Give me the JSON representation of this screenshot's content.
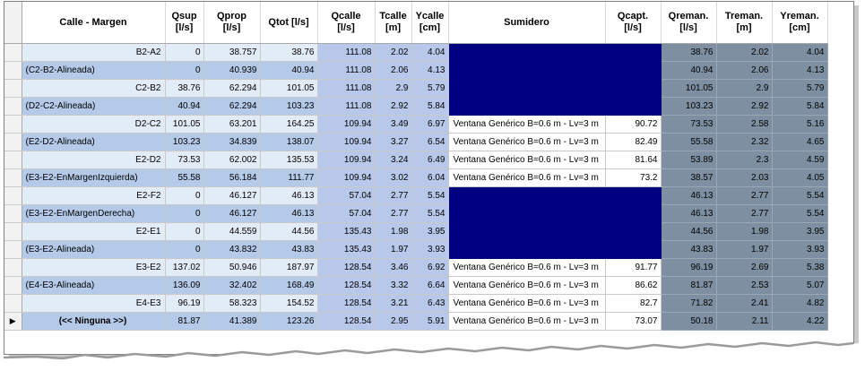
{
  "headers": {
    "name": "Calle - Margen",
    "qsup": "Qsup [l/s]",
    "qprop": "Qprop [l/s]",
    "qtot": "Qtot [l/s]",
    "qcalle": "Qcalle [l/s]",
    "tcalle": "Tcalle [m]",
    "ycalle": "Ycalle [cm]",
    "sumidero": "Sumidero",
    "qcapt": "Qcapt. [l/s]",
    "qreman": "Qreman. [l/s]",
    "treman": "Treman. [m]",
    "yreman": "Yreman. [cm]"
  },
  "current_row_indicator": "▶",
  "rows": [
    {
      "name": "B2-A2",
      "qsup": "0",
      "qprop": "38.757",
      "qtot": "38.76",
      "qcalle": "111.08",
      "tcalle": "2.02",
      "ycalle": "4.04",
      "sumidero": "",
      "qcapt": "",
      "qreman": "38.76",
      "treman": "2.02",
      "yreman": "4.04"
    },
    {
      "name": "(C2-B2-Alineada)",
      "qsup": "0",
      "qprop": "40.939",
      "qtot": "40.94",
      "qcalle": "111.08",
      "tcalle": "2.06",
      "ycalle": "4.13",
      "sumidero": "",
      "qcapt": "",
      "qreman": "40.94",
      "treman": "2.06",
      "yreman": "4.13"
    },
    {
      "name": "C2-B2",
      "qsup": "38.76",
      "qprop": "62.294",
      "qtot": "101.05",
      "qcalle": "111.08",
      "tcalle": "2.9",
      "ycalle": "5.79",
      "sumidero": "",
      "qcapt": "",
      "qreman": "101.05",
      "treman": "2.9",
      "yreman": "5.79"
    },
    {
      "name": "(D2-C2-Alineada)",
      "qsup": "40.94",
      "qprop": "62.294",
      "qtot": "103.23",
      "qcalle": "111.08",
      "tcalle": "2.92",
      "ycalle": "5.84",
      "sumidero": "",
      "qcapt": "",
      "qreman": "103.23",
      "treman": "2.92",
      "yreman": "5.84"
    },
    {
      "name": "D2-C2",
      "qsup": "101.05",
      "qprop": "63.201",
      "qtot": "164.25",
      "qcalle": "109.94",
      "tcalle": "3.49",
      "ycalle": "6.97",
      "sumidero": "Ventana Genérico B=0.6 m - Lv=3 m",
      "qcapt": "90.72",
      "qreman": "73.53",
      "treman": "2.58",
      "yreman": "5.16"
    },
    {
      "name": "(E2-D2-Alineada)",
      "qsup": "103.23",
      "qprop": "34.839",
      "qtot": "138.07",
      "qcalle": "109.94",
      "tcalle": "3.27",
      "ycalle": "6.54",
      "sumidero": "Ventana Genérico B=0.6 m - Lv=3 m",
      "qcapt": "82.49",
      "qreman": "55.58",
      "treman": "2.32",
      "yreman": "4.65"
    },
    {
      "name": "E2-D2",
      "qsup": "73.53",
      "qprop": "62.002",
      "qtot": "135.53",
      "qcalle": "109.94",
      "tcalle": "3.24",
      "ycalle": "6.49",
      "sumidero": "Ventana Genérico B=0.6 m - Lv=3 m",
      "qcapt": "81.64",
      "qreman": "53.89",
      "treman": "2.3",
      "yreman": "4.59"
    },
    {
      "name": "(E3-E2-EnMargenIzquierda)",
      "qsup": "55.58",
      "qprop": "56.184",
      "qtot": "111.77",
      "qcalle": "109.94",
      "tcalle": "3.02",
      "ycalle": "6.04",
      "sumidero": "Ventana Genérico B=0.6 m - Lv=3 m",
      "qcapt": "73.2",
      "qreman": "38.57",
      "treman": "2.03",
      "yreman": "4.05"
    },
    {
      "name": "E2-F2",
      "qsup": "0",
      "qprop": "46.127",
      "qtot": "46.13",
      "qcalle": "57.04",
      "tcalle": "2.77",
      "ycalle": "5.54",
      "sumidero": "",
      "qcapt": "",
      "qreman": "46.13",
      "treman": "2.77",
      "yreman": "5.54"
    },
    {
      "name": "(E3-E2-EnMargenDerecha)",
      "qsup": "0",
      "qprop": "46.127",
      "qtot": "46.13",
      "qcalle": "57.04",
      "tcalle": "2.77",
      "ycalle": "5.54",
      "sumidero": "",
      "qcapt": "",
      "qreman": "46.13",
      "treman": "2.77",
      "yreman": "5.54"
    },
    {
      "name": "E2-E1",
      "qsup": "0",
      "qprop": "44.559",
      "qtot": "44.56",
      "qcalle": "135.43",
      "tcalle": "1.98",
      "ycalle": "3.95",
      "sumidero": "",
      "qcapt": "",
      "qreman": "44.56",
      "treman": "1.98",
      "yreman": "3.95"
    },
    {
      "name": "(E3-E2-Alineada)",
      "qsup": "0",
      "qprop": "43.832",
      "qtot": "43.83",
      "qcalle": "135.43",
      "tcalle": "1.97",
      "ycalle": "3.93",
      "sumidero": "",
      "qcapt": "",
      "qreman": "43.83",
      "treman": "1.97",
      "yreman": "3.93"
    },
    {
      "name": "E3-E2",
      "qsup": "137.02",
      "qprop": "50.946",
      "qtot": "187.97",
      "qcalle": "128.54",
      "tcalle": "3.46",
      "ycalle": "6.92",
      "sumidero": "Ventana Genérico B=0.6 m - Lv=3 m",
      "qcapt": "91.77",
      "qreman": "96.19",
      "treman": "2.69",
      "yreman": "5.38"
    },
    {
      "name": "(E4-E3-Alineada)",
      "qsup": "136.09",
      "qprop": "32.402",
      "qtot": "168.49",
      "qcalle": "128.54",
      "tcalle": "3.32",
      "ycalle": "6.64",
      "sumidero": "Ventana Genérico B=0.6 m - Lv=3 m",
      "qcapt": "86.62",
      "qreman": "81.87",
      "treman": "2.53",
      "yreman": "5.07"
    },
    {
      "name": "E4-E3",
      "qsup": "96.19",
      "qprop": "58.323",
      "qtot": "154.52",
      "qcalle": "128.54",
      "tcalle": "3.21",
      "ycalle": "6.43",
      "sumidero": "Ventana Genérico B=0.6 m - Lv=3 m",
      "qcapt": "82.7",
      "qreman": "71.82",
      "treman": "2.41",
      "yreman": "4.82"
    },
    {
      "name": "(<< Ninguna >>)",
      "qsup": "81.87",
      "qprop": "41.389",
      "qtot": "123.26",
      "qcalle": "128.54",
      "tcalle": "2.95",
      "ycalle": "5.91",
      "sumidero": "Ventana Genérico B=0.6 m - Lv=3 m",
      "qcapt": "73.07",
      "qreman": "50.18",
      "treman": "2.11",
      "yreman": "4.22"
    }
  ],
  "colors": {
    "no_sumidero_fill": "#000080",
    "reman_fill": "#7d8fa1",
    "calle_fill": "#b8c8ea",
    "name_fill_light": "#e2ecf6",
    "name_fill_dark": "#b5c9e8"
  }
}
